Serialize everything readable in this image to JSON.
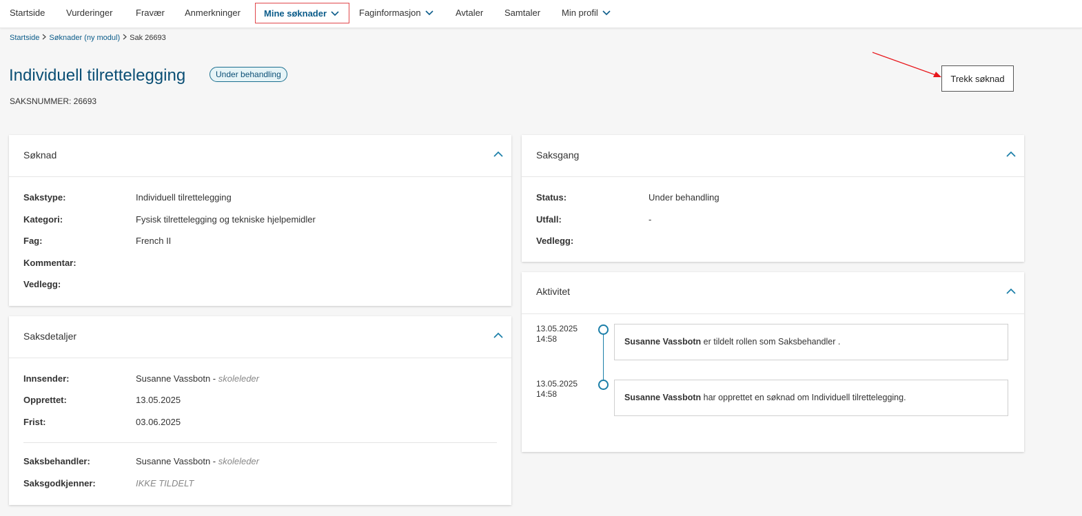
{
  "nav": {
    "items": [
      {
        "label": "Startside"
      },
      {
        "label": "Vurderinger"
      },
      {
        "label": "Fravær"
      },
      {
        "label": "Anmerkninger"
      },
      {
        "label": "Mine søknader",
        "active": true,
        "has_dropdown": true
      },
      {
        "label": "Faginformasjon",
        "has_dropdown": true
      },
      {
        "label": "Avtaler"
      },
      {
        "label": "Samtaler"
      },
      {
        "label": "Min profil",
        "has_dropdown": true
      }
    ]
  },
  "breadcrumb": {
    "items": [
      "Startside",
      "Søknader (ny modul)"
    ],
    "current": "Sak 26693"
  },
  "header": {
    "title": "Individuell tilrettelegging",
    "status": "Under behandling",
    "case_number": "SAKSNUMMER: 26693",
    "withdraw_label": "Trekk søknad"
  },
  "soknad": {
    "title": "Søknad",
    "rows": [
      {
        "label": "Sakstype:",
        "value": "Individuell tilrettelegging"
      },
      {
        "label": "Kategori:",
        "value": "Fysisk tilrettelegging og tekniske hjelpemidler"
      },
      {
        "label": "Fag:",
        "value": "French II"
      },
      {
        "label": "Kommentar:",
        "value": ""
      },
      {
        "label": "Vedlegg:",
        "value": ""
      }
    ]
  },
  "saksdetaljer": {
    "title": "Saksdetaljer",
    "innsender": {
      "label": "Innsender:",
      "name": "Susanne Vassbotn",
      "sep": " - ",
      "role": "skoleleder"
    },
    "opprettet": {
      "label": "Opprettet:",
      "value": "13.05.2025"
    },
    "frist": {
      "label": "Frist:",
      "value": "03.06.2025"
    },
    "saksbehandler": {
      "label": "Saksbehandler:",
      "name": "Susanne Vassbotn",
      "sep": " - ",
      "role": "skoleleder"
    },
    "saksgodkjenner": {
      "label": "Saksgodkjenner:",
      "value": "IKKE TILDELT"
    }
  },
  "saksgang": {
    "title": "Saksgang",
    "rows": [
      {
        "label": "Status:",
        "value": "Under behandling"
      },
      {
        "label": "Utfall:",
        "value": "-"
      },
      {
        "label": "Vedlegg:",
        "value": ""
      }
    ]
  },
  "aktivitet": {
    "title": "Aktivitet",
    "events": [
      {
        "date": "13.05.2025",
        "time": "14:58",
        "actor": "Susanne Vassbotn",
        "text": " er tildelt rollen som Saksbehandler ."
      },
      {
        "date": "13.05.2025",
        "time": "14:58",
        "actor": "Susanne Vassbotn",
        "text": " har opprettet en søknad om Individuell tilrettelegging."
      }
    ]
  },
  "colors": {
    "accent": "#0b5c8a",
    "title": "#0b4f75",
    "highlight_border": "#e0464a",
    "annotation_arrow": "#e8161b"
  }
}
